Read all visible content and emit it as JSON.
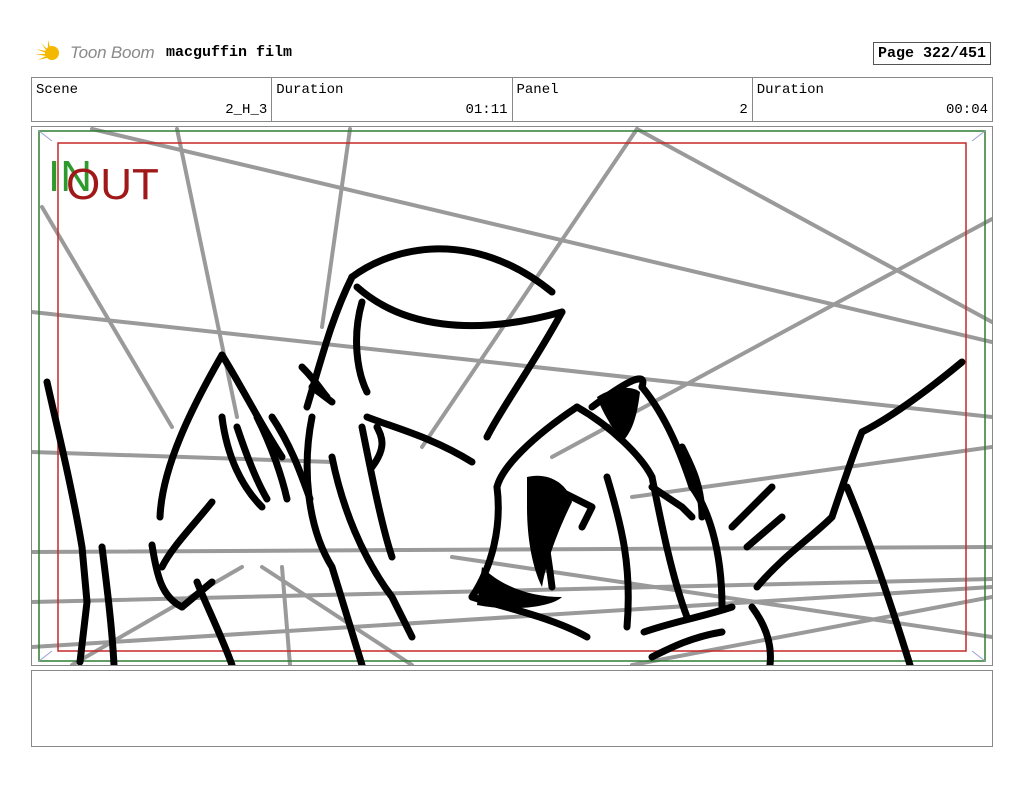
{
  "header": {
    "logo_text": "Toon Boom",
    "project_title": "macguffin film",
    "page": "Page 322/451"
  },
  "info": [
    {
      "label": "Scene",
      "value": "2_H_3"
    },
    {
      "label": "Duration",
      "value": "01:11"
    },
    {
      "label": "Panel",
      "value": "2"
    },
    {
      "label": "Duration",
      "value": "00:04"
    }
  ],
  "panel": {
    "in_label": "IN",
    "out_label": "OUT",
    "colors": {
      "in": "#2e9a2e",
      "out": "#a01818",
      "frame_green": "#2e7d32",
      "frame_red": "#c62828",
      "guide_lines": "#9a9a9a",
      "sketch": "#000000"
    }
  },
  "notes": {
    "text": ""
  }
}
